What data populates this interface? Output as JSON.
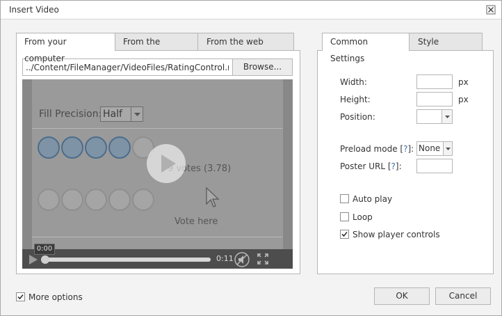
{
  "dialog": {
    "title": "Insert Video"
  },
  "source_tabs": [
    {
      "label": "From your computer"
    },
    {
      "label": "From the gallery"
    },
    {
      "label": "From the web (URL)"
    }
  ],
  "file": {
    "path": "../Content/FileManager/VideoFiles/RatingControl.mp4",
    "browse_label": "Browse..."
  },
  "video": {
    "precision_label": "Fill Precision:",
    "precision_value": "Half",
    "votes_text": "9 votes (3.78)",
    "vote_here_text": "Vote here",
    "time_tooltip": "0:00",
    "duration": "0:11"
  },
  "settings_tabs": [
    {
      "label": "Common Settings"
    },
    {
      "label": "Style Settings"
    }
  ],
  "settings": {
    "width_label": "Width:",
    "width_value": "",
    "height_label": "Height:",
    "height_value": "",
    "unit": "px",
    "position_label": "Position:",
    "position_value": "",
    "preload_label_text": "Preload mode",
    "preload_value": "None",
    "poster_label_text": "Poster URL",
    "poster_value": "",
    "help_mark": "?",
    "autoplay_label": "Auto play",
    "autoplay_checked": false,
    "loop_label": "Loop",
    "loop_checked": false,
    "controls_label": "Show player controls",
    "controls_checked": true
  },
  "footer": {
    "more_options_label": "More options",
    "more_options_checked": true,
    "ok_label": "OK",
    "cancel_label": "Cancel"
  }
}
